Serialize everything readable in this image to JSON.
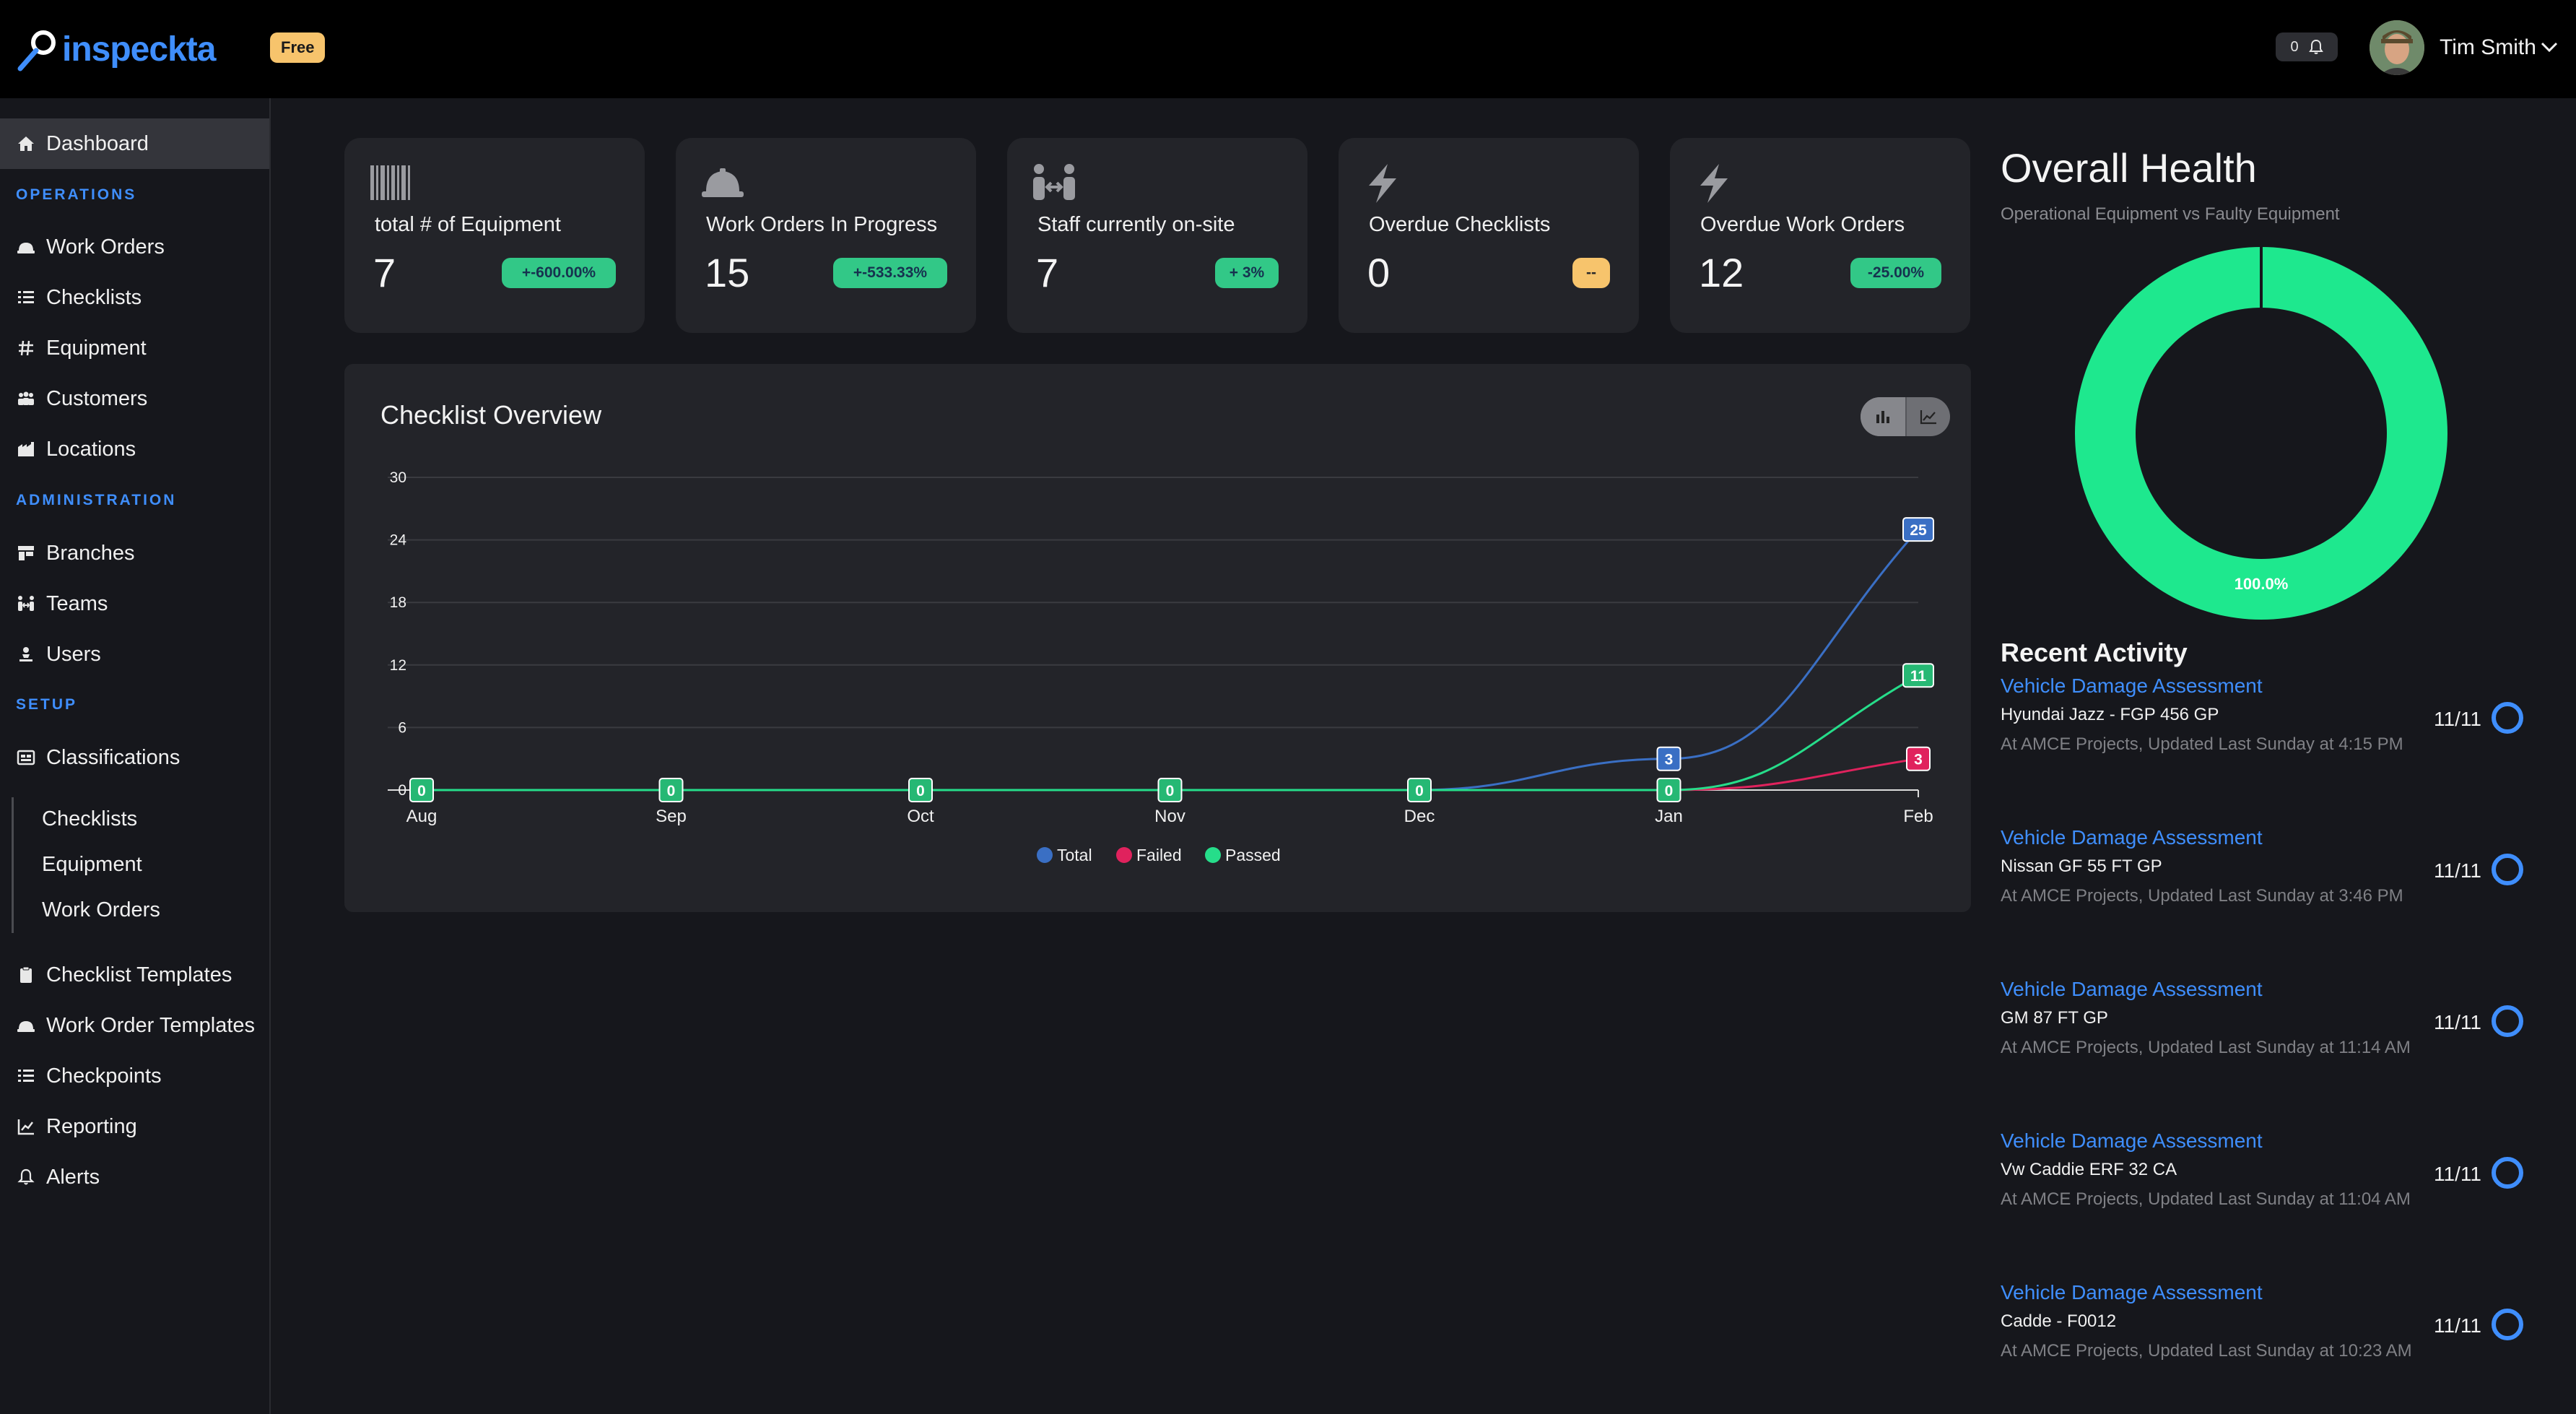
{
  "brand": {
    "name": "inspeckta",
    "plan": "Free"
  },
  "header": {
    "notification_count": "0",
    "user_name": "Tim Smith"
  },
  "sidebar": {
    "dashboard": "Dashboard",
    "operations_label": "OPERATIONS",
    "operations": [
      "Work Orders",
      "Checklists",
      "Equipment",
      "Customers",
      "Locations"
    ],
    "administration_label": "ADMINISTRATION",
    "administration": [
      "Branches",
      "Teams",
      "Users"
    ],
    "setup_label": "SETUP",
    "classifications": "Classifications",
    "classification_sub": [
      "Checklists",
      "Equipment",
      "Work Orders"
    ],
    "tools": [
      "Checklist Templates",
      "Work Order Templates",
      "Checkpoints",
      "Reporting",
      "Alerts"
    ]
  },
  "stats": [
    {
      "title": "total # of Equipment",
      "value": "7",
      "change": "+-600.00%"
    },
    {
      "title": "Work Orders In Progress",
      "value": "15",
      "change": "+-533.33%"
    },
    {
      "title": "Staff currently on-site",
      "value": "7",
      "change": "+ 3%"
    },
    {
      "title": "Overdue Checklists",
      "value": "0",
      "change": "--"
    },
    {
      "title": "Overdue Work Orders",
      "value": "12",
      "change": "-25.00%"
    }
  ],
  "checklist_overview": {
    "title": "Checklist Overview"
  },
  "chart_data": [
    {
      "type": "line",
      "title": "Checklist Overview",
      "categories": [
        "Aug",
        "Sep",
        "Oct",
        "Nov",
        "Dec",
        "Jan",
        "Feb"
      ],
      "ylim": [
        0,
        30
      ],
      "yticks": [
        0,
        6,
        12,
        18,
        24,
        30
      ],
      "grid": true,
      "legend": "bottom",
      "series": [
        {
          "name": "Total",
          "color": "#3a6fc4",
          "values": [
            0,
            0,
            0,
            0,
            0,
            3,
            25
          ]
        },
        {
          "name": "Failed",
          "color": "#e0225d",
          "values": [
            0,
            0,
            0,
            0,
            0,
            0,
            3
          ]
        },
        {
          "name": "Passed",
          "color": "#26dd8a",
          "values": [
            0,
            0,
            0,
            0,
            0,
            0,
            11
          ]
        }
      ]
    },
    {
      "type": "pie",
      "title": "Overall Health",
      "subtitle": "Operational Equipment vs Faulty Equipment",
      "slices": [
        {
          "value": 100.0,
          "label": "100.0%",
          "color": "#1ee88e"
        }
      ]
    }
  ],
  "health": {
    "title": "Overall Health",
    "subtitle": "Operational Equipment vs Faulty Equipment"
  },
  "recent_activity": {
    "title": "Recent Activity",
    "items": [
      {
        "title": "Vehicle Damage Assessment",
        "subject": "Hyundai Jazz - FGP 456 GP",
        "meta": "At AMCE Projects, Updated Last Sunday at 4:15 PM",
        "count": "11/11"
      },
      {
        "title": "Vehicle Damage Assessment",
        "subject": "Nissan GF 55 FT GP",
        "meta": "At AMCE Projects, Updated Last Sunday at 3:46 PM",
        "count": "11/11"
      },
      {
        "title": "Vehicle Damage Assessment",
        "subject": "GM 87 FT GP",
        "meta": "At AMCE Projects, Updated Last Sunday at 11:14 AM",
        "count": "11/11"
      },
      {
        "title": "Vehicle Damage Assessment",
        "subject": "Vw Caddie ERF 32 CA",
        "meta": "At AMCE Projects, Updated Last Sunday at 11:04 AM",
        "count": "11/11"
      },
      {
        "title": "Vehicle Damage Assessment",
        "subject": "Cadde - F0012",
        "meta": "At AMCE Projects, Updated Last Sunday at 10:23 AM",
        "count": "11/11"
      }
    ]
  },
  "colors": {
    "accent": "#3f8efc",
    "positive": "#32c887",
    "warning": "#f7c46c",
    "background": "#16171c",
    "card": "#232429"
  }
}
